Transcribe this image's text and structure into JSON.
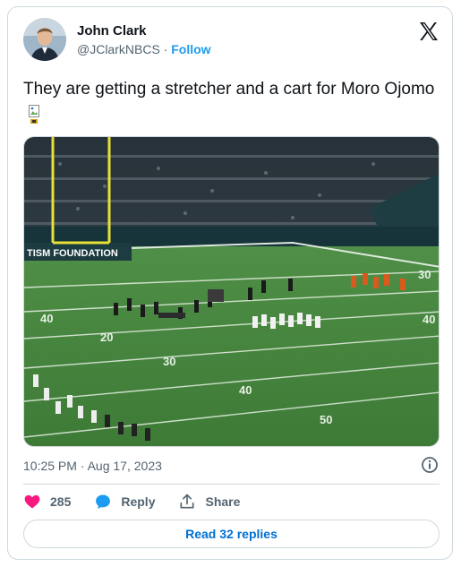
{
  "author": {
    "name": "John Clark",
    "handle": "@JClarkNBCS",
    "separator": "·",
    "follow_label": "Follow"
  },
  "tweet": {
    "text": "They are getting a stretcher and a cart for Moro Ojomo"
  },
  "media": {
    "signage_text": "TISM FOUNDATION",
    "yard_numbers": [
      "40",
      "20",
      "30",
      "40",
      "50",
      "30",
      "40"
    ]
  },
  "meta": {
    "timestamp": "10:25 PM · Aug 17, 2023"
  },
  "actions": {
    "like_count": "285",
    "reply_label": "Reply",
    "share_label": "Share"
  },
  "footer": {
    "read_replies_label": "Read 32 replies"
  },
  "colors": {
    "accent": "#1d9bf0",
    "like": "#f91880",
    "text_secondary": "#536471"
  },
  "icons": [
    "x-logo-icon",
    "info-icon",
    "heart-icon",
    "reply-bubble-icon",
    "share-icon",
    "broken-image-icon"
  ]
}
